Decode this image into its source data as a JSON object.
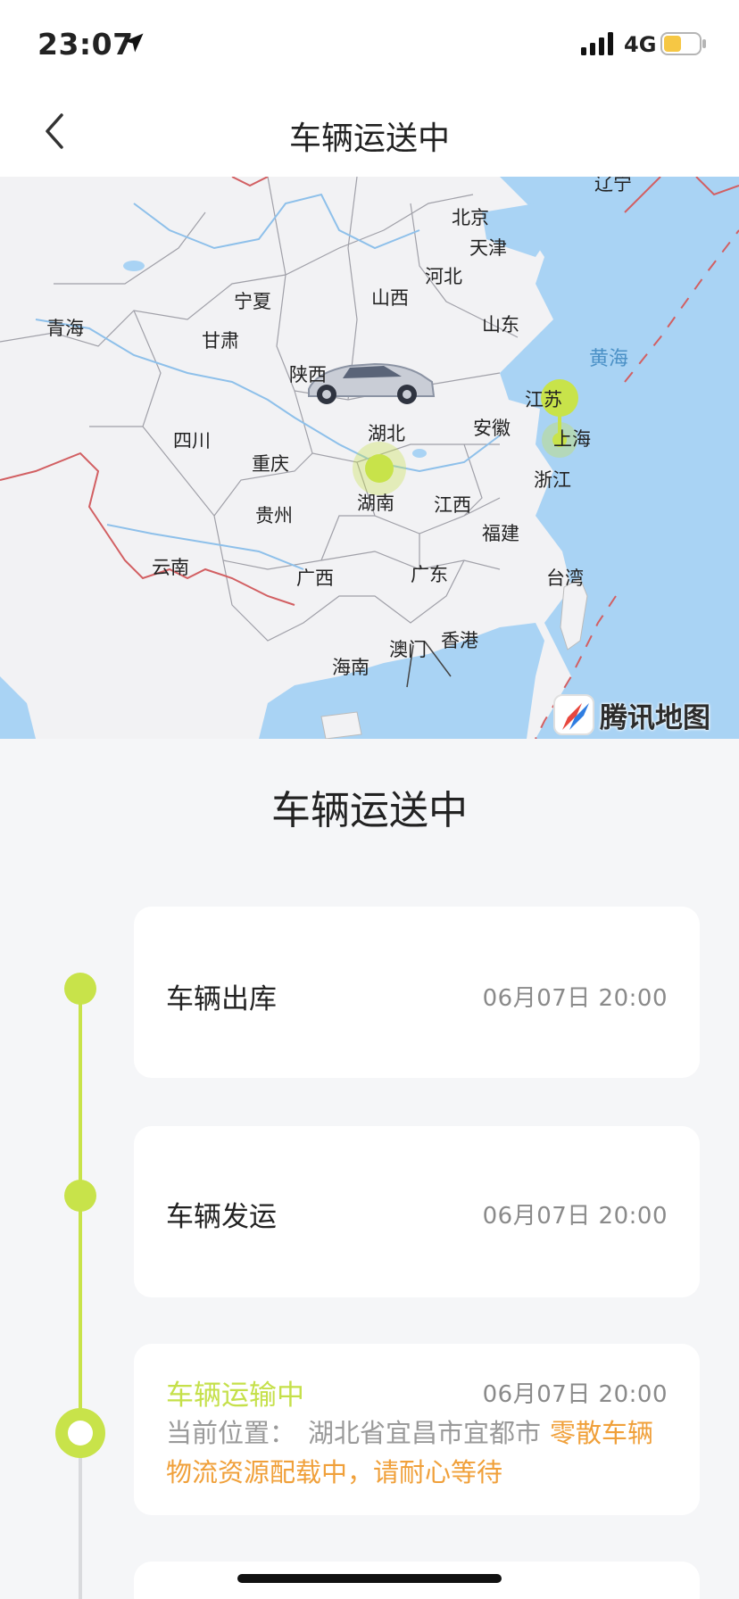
{
  "status_bar": {
    "time": "23:07",
    "network": "4G",
    "icons": [
      "location-arrow-icon",
      "signal-icon",
      "battery-icon"
    ],
    "battery_color": "#f6c744"
  },
  "nav": {
    "back_icon": "chevron-left-icon",
    "title": "车辆运送中"
  },
  "map": {
    "provider": "腾讯地图",
    "sea_label": "黄海",
    "region_labels": [
      "辽宁",
      "北京",
      "天津",
      "河北",
      "山西",
      "宁夏",
      "青海",
      "甘肃",
      "山东",
      "陕西",
      "江苏",
      "安徽",
      "湖北",
      "上海",
      "四川",
      "重庆",
      "浙江",
      "湖南",
      "江西",
      "贵州",
      "福建",
      "云南",
      "广西",
      "广东",
      "台湾",
      "澳门",
      "香港",
      "海南"
    ],
    "marker_colors": {
      "accent": "#c8e34a",
      "sea": "#a9d3f4",
      "land": "#f2f2f4",
      "border": "#d25f62"
    }
  },
  "section_title": "车辆运送中",
  "timeline": [
    {
      "title": "车辆出库",
      "time": "06月07日 20:00",
      "state": "done"
    },
    {
      "title": "车辆发运",
      "time": "06月07日 20:00",
      "state": "done"
    },
    {
      "title": "车辆运输中",
      "time": "06月07日 20:00",
      "state": "current",
      "location_label": "当前位置：",
      "location": "湖北省宜昌市宜都市",
      "notice_part1": "零散车辆",
      "notice_part2": "物流资源配载中，请耐心等待"
    }
  ],
  "colors": {
    "accent_green": "#c8e34a",
    "notice_orange": "#f0a03a",
    "time_grey": "#8a8a8a"
  }
}
